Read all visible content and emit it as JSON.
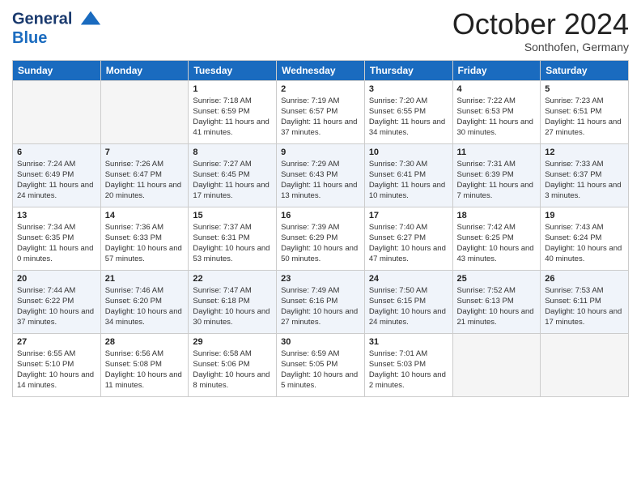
{
  "header": {
    "logo_line1": "General",
    "logo_line2": "Blue",
    "month": "October 2024",
    "location": "Sonthofen, Germany"
  },
  "days_of_week": [
    "Sunday",
    "Monday",
    "Tuesday",
    "Wednesday",
    "Thursday",
    "Friday",
    "Saturday"
  ],
  "weeks": [
    [
      {
        "day": "",
        "info": ""
      },
      {
        "day": "",
        "info": ""
      },
      {
        "day": "1",
        "info": "Sunrise: 7:18 AM\nSunset: 6:59 PM\nDaylight: 11 hours and 41 minutes."
      },
      {
        "day": "2",
        "info": "Sunrise: 7:19 AM\nSunset: 6:57 PM\nDaylight: 11 hours and 37 minutes."
      },
      {
        "day": "3",
        "info": "Sunrise: 7:20 AM\nSunset: 6:55 PM\nDaylight: 11 hours and 34 minutes."
      },
      {
        "day": "4",
        "info": "Sunrise: 7:22 AM\nSunset: 6:53 PM\nDaylight: 11 hours and 30 minutes."
      },
      {
        "day": "5",
        "info": "Sunrise: 7:23 AM\nSunset: 6:51 PM\nDaylight: 11 hours and 27 minutes."
      }
    ],
    [
      {
        "day": "6",
        "info": "Sunrise: 7:24 AM\nSunset: 6:49 PM\nDaylight: 11 hours and 24 minutes."
      },
      {
        "day": "7",
        "info": "Sunrise: 7:26 AM\nSunset: 6:47 PM\nDaylight: 11 hours and 20 minutes."
      },
      {
        "day": "8",
        "info": "Sunrise: 7:27 AM\nSunset: 6:45 PM\nDaylight: 11 hours and 17 minutes."
      },
      {
        "day": "9",
        "info": "Sunrise: 7:29 AM\nSunset: 6:43 PM\nDaylight: 11 hours and 13 minutes."
      },
      {
        "day": "10",
        "info": "Sunrise: 7:30 AM\nSunset: 6:41 PM\nDaylight: 11 hours and 10 minutes."
      },
      {
        "day": "11",
        "info": "Sunrise: 7:31 AM\nSunset: 6:39 PM\nDaylight: 11 hours and 7 minutes."
      },
      {
        "day": "12",
        "info": "Sunrise: 7:33 AM\nSunset: 6:37 PM\nDaylight: 11 hours and 3 minutes."
      }
    ],
    [
      {
        "day": "13",
        "info": "Sunrise: 7:34 AM\nSunset: 6:35 PM\nDaylight: 11 hours and 0 minutes."
      },
      {
        "day": "14",
        "info": "Sunrise: 7:36 AM\nSunset: 6:33 PM\nDaylight: 10 hours and 57 minutes."
      },
      {
        "day": "15",
        "info": "Sunrise: 7:37 AM\nSunset: 6:31 PM\nDaylight: 10 hours and 53 minutes."
      },
      {
        "day": "16",
        "info": "Sunrise: 7:39 AM\nSunset: 6:29 PM\nDaylight: 10 hours and 50 minutes."
      },
      {
        "day": "17",
        "info": "Sunrise: 7:40 AM\nSunset: 6:27 PM\nDaylight: 10 hours and 47 minutes."
      },
      {
        "day": "18",
        "info": "Sunrise: 7:42 AM\nSunset: 6:25 PM\nDaylight: 10 hours and 43 minutes."
      },
      {
        "day": "19",
        "info": "Sunrise: 7:43 AM\nSunset: 6:24 PM\nDaylight: 10 hours and 40 minutes."
      }
    ],
    [
      {
        "day": "20",
        "info": "Sunrise: 7:44 AM\nSunset: 6:22 PM\nDaylight: 10 hours and 37 minutes."
      },
      {
        "day": "21",
        "info": "Sunrise: 7:46 AM\nSunset: 6:20 PM\nDaylight: 10 hours and 34 minutes."
      },
      {
        "day": "22",
        "info": "Sunrise: 7:47 AM\nSunset: 6:18 PM\nDaylight: 10 hours and 30 minutes."
      },
      {
        "day": "23",
        "info": "Sunrise: 7:49 AM\nSunset: 6:16 PM\nDaylight: 10 hours and 27 minutes."
      },
      {
        "day": "24",
        "info": "Sunrise: 7:50 AM\nSunset: 6:15 PM\nDaylight: 10 hours and 24 minutes."
      },
      {
        "day": "25",
        "info": "Sunrise: 7:52 AM\nSunset: 6:13 PM\nDaylight: 10 hours and 21 minutes."
      },
      {
        "day": "26",
        "info": "Sunrise: 7:53 AM\nSunset: 6:11 PM\nDaylight: 10 hours and 17 minutes."
      }
    ],
    [
      {
        "day": "27",
        "info": "Sunrise: 6:55 AM\nSunset: 5:10 PM\nDaylight: 10 hours and 14 minutes."
      },
      {
        "day": "28",
        "info": "Sunrise: 6:56 AM\nSunset: 5:08 PM\nDaylight: 10 hours and 11 minutes."
      },
      {
        "day": "29",
        "info": "Sunrise: 6:58 AM\nSunset: 5:06 PM\nDaylight: 10 hours and 8 minutes."
      },
      {
        "day": "30",
        "info": "Sunrise: 6:59 AM\nSunset: 5:05 PM\nDaylight: 10 hours and 5 minutes."
      },
      {
        "day": "31",
        "info": "Sunrise: 7:01 AM\nSunset: 5:03 PM\nDaylight: 10 hours and 2 minutes."
      },
      {
        "day": "",
        "info": ""
      },
      {
        "day": "",
        "info": ""
      }
    ]
  ]
}
